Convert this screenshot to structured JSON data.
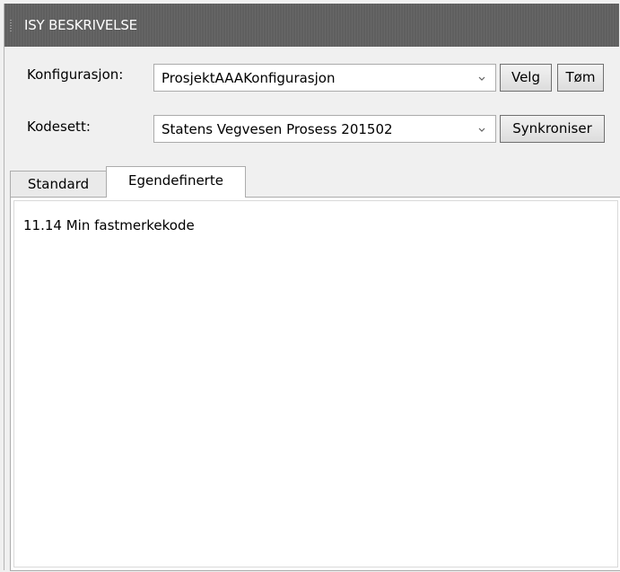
{
  "titlebar": {
    "title": "ISY BESKRIVELSE"
  },
  "config": {
    "label": "Konfigurasjon:",
    "selected": "ProsjektAAAKonfigurasjon",
    "velg_label": "Velg",
    "tom_label": "Tøm"
  },
  "codeset": {
    "label": "Kodesett:",
    "selected": "Statens Vegvesen Prosess 201502",
    "sync_label": "Synkroniser"
  },
  "tabs": [
    {
      "label": "Standard",
      "active": false
    },
    {
      "label": "Egendefinerte",
      "active": true
    }
  ],
  "list": {
    "items": [
      {
        "label": "11.14  Min fastmerkekode"
      }
    ]
  },
  "colors": {
    "titlebar_bg": "#5f5f5f",
    "panel_bg": "#f0f0f0"
  }
}
